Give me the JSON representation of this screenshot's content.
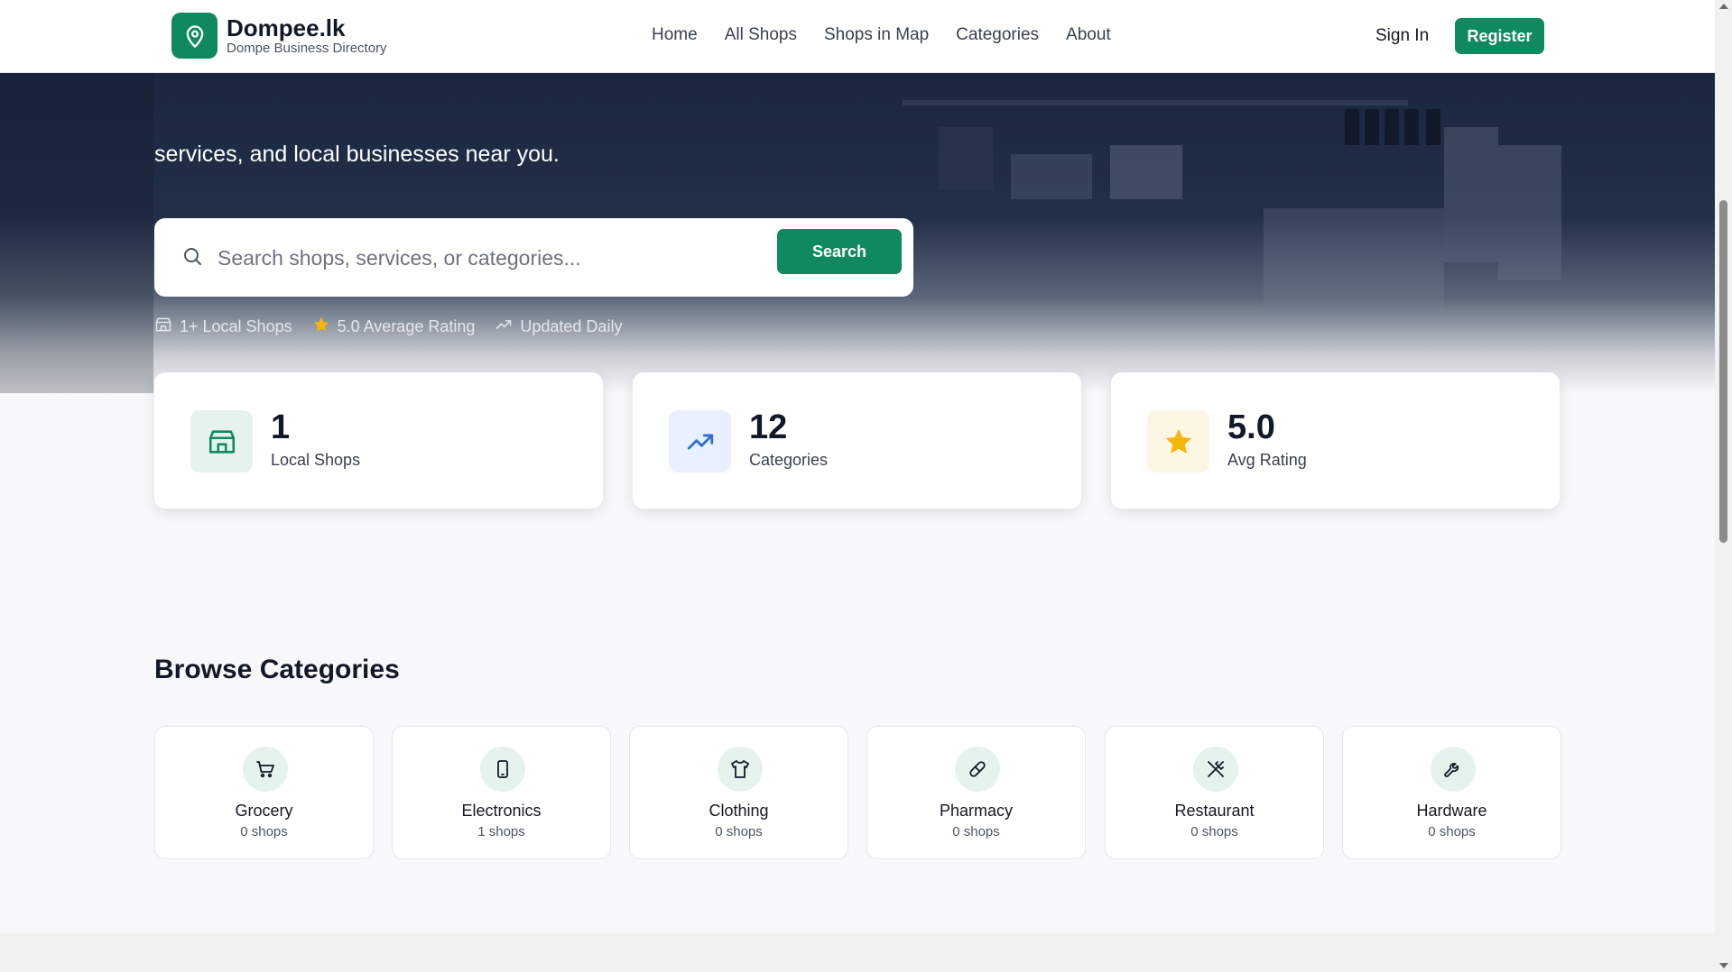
{
  "brand": {
    "name": "Dompee.lk",
    "subtitle": "Dompe Business Directory",
    "color": "#0f8a5f"
  },
  "nav": {
    "items": [
      "Home",
      "All Shops",
      "Shops in Map",
      "Categories",
      "About"
    ],
    "signin": "Sign In",
    "register": "Register"
  },
  "hero": {
    "tagline": "services, and local businesses near you.",
    "search_placeholder": "Search shops, services, or categories...",
    "search_button": "Search",
    "meta": [
      "1+ Local Shops",
      "5.0 Average Rating",
      "Updated Daily"
    ]
  },
  "stats": [
    {
      "value": "1",
      "label": "Local Shops",
      "icon": "store-icon"
    },
    {
      "value": "12",
      "label": "Categories",
      "icon": "trending-up-icon"
    },
    {
      "value": "5.0",
      "label": "Avg Rating",
      "icon": "star-icon"
    }
  ],
  "categories_section": {
    "title": "Browse Categories",
    "items": [
      {
        "name": "Grocery",
        "count": "0 shops",
        "icon": "cart-icon"
      },
      {
        "name": "Electronics",
        "count": "1 shops",
        "icon": "phone-icon"
      },
      {
        "name": "Clothing",
        "count": "0 shops",
        "icon": "shirt-icon"
      },
      {
        "name": "Pharmacy",
        "count": "0 shops",
        "icon": "pill-icon"
      },
      {
        "name": "Restaurant",
        "count": "0 shops",
        "icon": "utensils-icon"
      },
      {
        "name": "Hardware",
        "count": "0 shops",
        "icon": "wrench-icon"
      }
    ]
  }
}
